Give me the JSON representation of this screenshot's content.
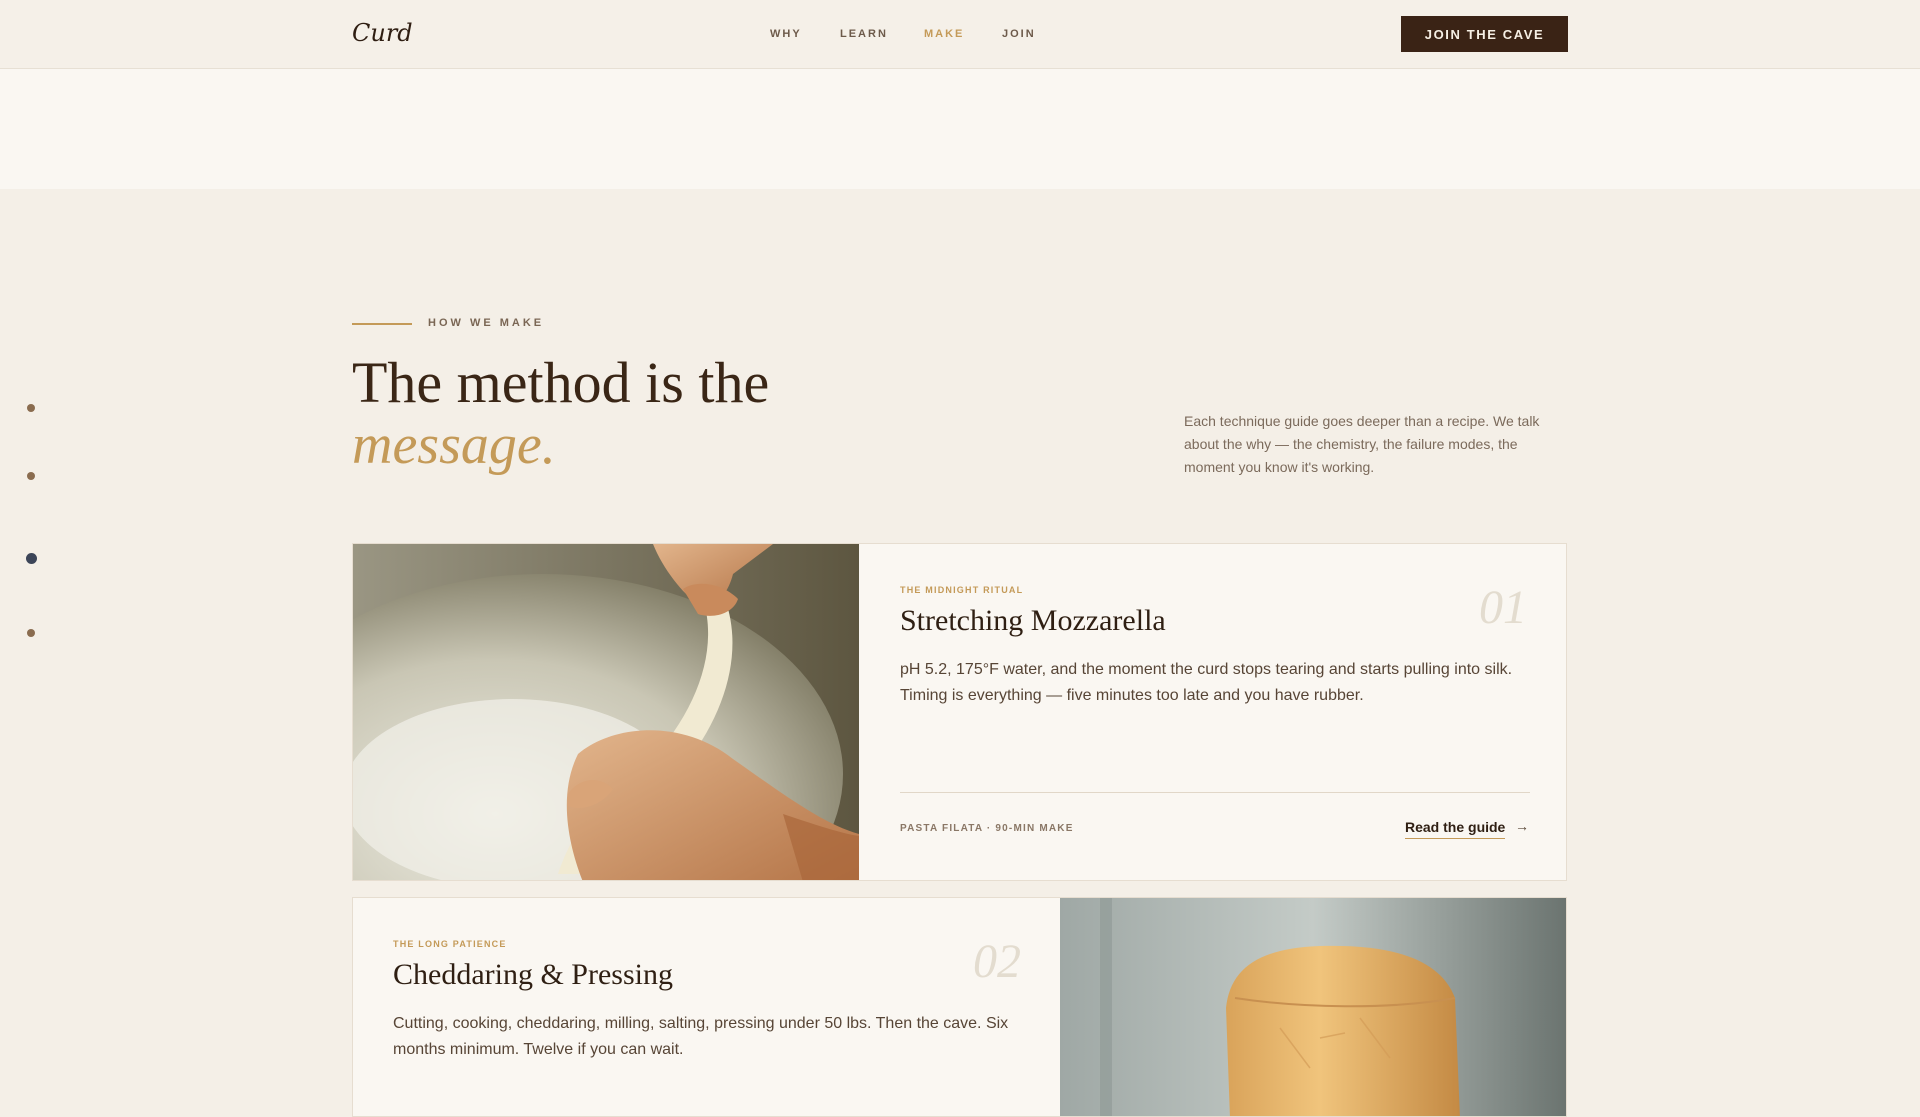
{
  "nav": {
    "logo": "Curd",
    "links": [
      "WHY",
      "LEARN",
      "MAKE",
      "JOIN"
    ],
    "active": "MAKE",
    "cta": "JOIN THE CAVE"
  },
  "section": {
    "eyebrow": "HOW WE MAKE",
    "title_line1": "The method is the",
    "title_line2": "message.",
    "intro": "Each technique guide goes deeper than a recipe. We talk about the why — the chemistry, the failure modes, the moment you know it's working."
  },
  "guides": [
    {
      "tag": "THE MIDNIGHT RITUAL",
      "number": "01",
      "title": "Stretching Mozzarella",
      "body": "pH 5.2, 175°F water, and the moment the curd stops tearing and starts pulling into silk. Timing is everything — five minutes too late and you have rubber.",
      "meta": "PASTA FILATA · 90-MIN MAKE",
      "link": "Read the guide"
    },
    {
      "tag": "THE LONG PATIENCE",
      "number": "02",
      "title": "Cheddaring & Pressing",
      "body": "Cutting, cooking, cheddaring, milling, salting, pressing under 50 lbs. Then the cave. Six months minimum. Twelve if you can wait."
    }
  ],
  "colors": {
    "accent": "#c49a58",
    "ink": "#3a2315",
    "background": "#f4efe7"
  },
  "section_dots": 4,
  "active_dot": 3
}
